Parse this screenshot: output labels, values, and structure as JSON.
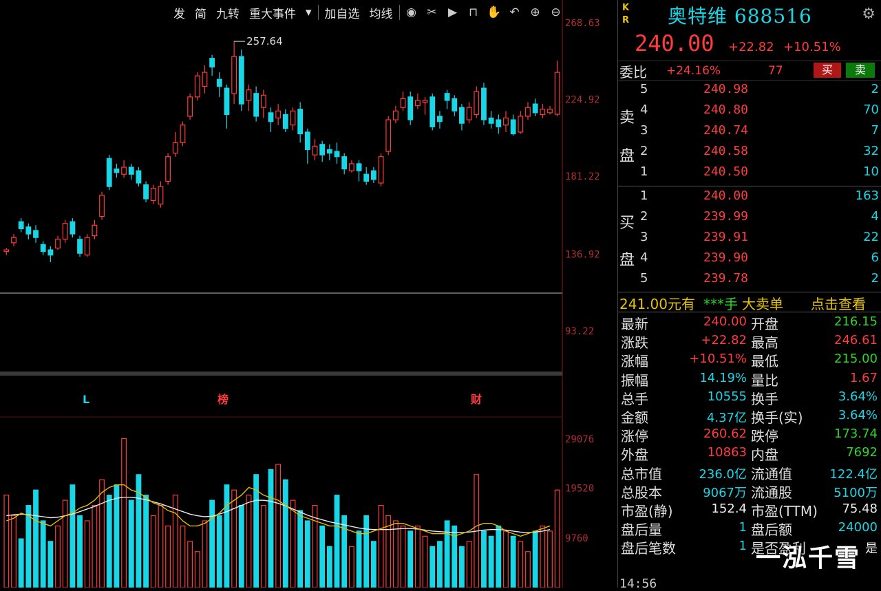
{
  "toolbar": {
    "items": [
      "发",
      "简",
      "九转",
      "重大事件",
      "加自选",
      "均线"
    ],
    "icons": [
      "eye-icon",
      "scissors-icon",
      "play-icon",
      "lock-icon",
      "hand-icon",
      "undo-icon",
      "zoom-in-icon",
      "zoom-out-icon"
    ]
  },
  "stock": {
    "kr": [
      "K",
      "R"
    ],
    "name": "奥特维 688516",
    "price": "240.00",
    "change": "+22.82",
    "change_pct": "+10.51%"
  },
  "weibi": {
    "label": "委比",
    "pct": "+24.16%",
    "diff": "77",
    "buy_btn": "买",
    "sell_btn": "卖"
  },
  "asks": {
    "side_label_1": "卖",
    "side_label_2": "盘",
    "rows": [
      {
        "lv": "5",
        "px": "240.98",
        "vol": "2"
      },
      {
        "lv": "4",
        "px": "240.80",
        "vol": "70"
      },
      {
        "lv": "3",
        "px": "240.74",
        "vol": "7"
      },
      {
        "lv": "2",
        "px": "240.58",
        "vol": "32"
      },
      {
        "lv": "1",
        "px": "240.50",
        "vol": "10"
      }
    ]
  },
  "bids": {
    "side_label_1": "买",
    "side_label_2": "盘",
    "rows": [
      {
        "lv": "1",
        "px": "240.00",
        "vol": "163"
      },
      {
        "lv": "2",
        "px": "239.99",
        "vol": "4"
      },
      {
        "lv": "3",
        "px": "239.91",
        "vol": "22"
      },
      {
        "lv": "4",
        "px": "239.90",
        "vol": "6"
      },
      {
        "lv": "5",
        "px": "239.78",
        "vol": "2"
      }
    ]
  },
  "ad": {
    "price": "241.00元有",
    "hand": "***手",
    "big": "大卖单",
    "link": "点击查看"
  },
  "stats": [
    {
      "k1": "最新",
      "v1": "240.00",
      "c1": "red",
      "k2": "开盘",
      "v2": "216.15",
      "c2": "green"
    },
    {
      "k1": "涨跌",
      "v1": "+22.82",
      "c1": "red",
      "k2": "最高",
      "v2": "246.61",
      "c2": "red"
    },
    {
      "k1": "涨幅",
      "v1": "+10.51%",
      "c1": "red",
      "k2": "最低",
      "v2": "215.00",
      "c2": "green"
    },
    {
      "k1": "振幅",
      "v1": "14.19%",
      "c1": "cyan",
      "k2": "量比",
      "v2": "1.67",
      "c2": "red"
    },
    {
      "k1": "总手",
      "v1": "10555",
      "c1": "cyan",
      "k2": "换手",
      "v2": "3.64%",
      "c2": "cyan"
    },
    {
      "k1": "金额",
      "v1": "4.37亿",
      "c1": "cyan",
      "k2": "换手(实)",
      "v2": "3.64%",
      "c2": "cyan"
    },
    {
      "k1": "涨停",
      "v1": "260.62",
      "c1": "red",
      "k2": "跌停",
      "v2": "173.74",
      "c2": "green"
    },
    {
      "k1": "外盘",
      "v1": "10863",
      "c1": "red",
      "k2": "内盘",
      "v2": "7692",
      "c2": "green"
    },
    {
      "k1": "总市值",
      "v1": "236.0亿",
      "c1": "cyan",
      "k2": "流通值",
      "v2": "122.4亿",
      "c2": "cyan"
    },
    {
      "k1": "总股本",
      "v1": "9067万",
      "c1": "cyan",
      "k2": "流通股",
      "v2": "5100万",
      "c2": "cyan"
    },
    {
      "k1": "市盈(静)",
      "v1": "152.4",
      "c1": "white",
      "k2": "市盈(TTM)",
      "v2": "75.48",
      "c2": "white"
    },
    {
      "k1": "盘后量",
      "v1": "1",
      "c1": "cyan",
      "k2": "盘后额",
      "v2": "24000",
      "c2": "cyan"
    },
    {
      "k1": "盘后笔数",
      "v1": "1",
      "c1": "cyan",
      "k2": "是否盈利",
      "v2": "是",
      "c2": "white"
    }
  ],
  "watermark": "一泓千雪",
  "bottom_time": "14:56",
  "chart_data": {
    "type": "candlestick",
    "price_axis_ticks": [
      "268.63",
      "224.92",
      "181.22",
      "136.92",
      "93.22"
    ],
    "ylim": [
      93.22,
      268.63
    ],
    "peak_label": "257.64",
    "event_markers": [
      "L",
      "榜",
      "财"
    ],
    "volume_axis_ticks": [
      "29076",
      "19520",
      "9760"
    ],
    "volume_ylim": [
      0,
      29076
    ],
    "candles": [
      {
        "o": 138,
        "c": 139,
        "h": 140,
        "l": 136,
        "up": true
      },
      {
        "o": 143,
        "c": 146,
        "h": 148,
        "l": 141,
        "up": true
      },
      {
        "o": 155,
        "c": 151,
        "h": 157,
        "l": 149,
        "up": false
      },
      {
        "o": 152,
        "c": 148,
        "h": 154,
        "l": 145,
        "up": false
      },
      {
        "o": 150,
        "c": 146,
        "h": 153,
        "l": 143,
        "up": false
      },
      {
        "o": 142,
        "c": 138,
        "h": 144,
        "l": 136,
        "up": false
      },
      {
        "o": 139,
        "c": 136,
        "h": 141,
        "l": 132,
        "up": false
      },
      {
        "o": 140,
        "c": 145,
        "h": 147,
        "l": 139,
        "up": true
      },
      {
        "o": 145,
        "c": 154,
        "h": 156,
        "l": 143,
        "up": true
      },
      {
        "o": 155,
        "c": 148,
        "h": 157,
        "l": 146,
        "up": false
      },
      {
        "o": 145,
        "c": 137,
        "h": 147,
        "l": 135,
        "up": false
      },
      {
        "o": 136,
        "c": 146,
        "h": 148,
        "l": 135,
        "up": true
      },
      {
        "o": 147,
        "c": 153,
        "h": 156,
        "l": 145,
        "up": true
      },
      {
        "o": 158,
        "c": 170,
        "h": 172,
        "l": 156,
        "up": true
      },
      {
        "o": 191,
        "c": 175,
        "h": 193,
        "l": 173,
        "up": false
      },
      {
        "o": 185,
        "c": 183,
        "h": 188,
        "l": 180,
        "up": false
      },
      {
        "o": 182,
        "c": 186,
        "h": 190,
        "l": 180,
        "up": true
      },
      {
        "o": 186,
        "c": 182,
        "h": 188,
        "l": 179,
        "up": false
      },
      {
        "o": 184,
        "c": 177,
        "h": 186,
        "l": 175,
        "up": false
      },
      {
        "o": 176,
        "c": 168,
        "h": 178,
        "l": 166,
        "up": false
      },
      {
        "o": 167,
        "c": 174,
        "h": 176,
        "l": 165,
        "up": true
      },
      {
        "o": 165,
        "c": 175,
        "h": 178,
        "l": 163,
        "up": true
      },
      {
        "o": 178,
        "c": 192,
        "h": 194,
        "l": 176,
        "up": true
      },
      {
        "o": 194,
        "c": 200,
        "h": 206,
        "l": 192,
        "up": true
      },
      {
        "o": 200,
        "c": 210,
        "h": 212,
        "l": 198,
        "up": true
      },
      {
        "o": 215,
        "c": 226,
        "h": 228,
        "l": 213,
        "up": true
      },
      {
        "o": 226,
        "c": 238,
        "h": 240,
        "l": 224,
        "up": true
      },
      {
        "o": 232,
        "c": 240,
        "h": 244,
        "l": 228,
        "up": true
      },
      {
        "o": 248,
        "c": 243,
        "h": 250,
        "l": 238,
        "up": false
      },
      {
        "o": 236,
        "c": 232,
        "h": 240,
        "l": 226,
        "up": false
      },
      {
        "o": 231,
        "c": 216,
        "h": 233,
        "l": 208,
        "up": false
      },
      {
        "o": 228,
        "c": 249,
        "h": 257.64,
        "l": 222,
        "up": true
      },
      {
        "o": 249,
        "c": 222,
        "h": 253,
        "l": 218,
        "up": false
      },
      {
        "o": 224,
        "c": 230,
        "h": 233,
        "l": 218,
        "up": true
      },
      {
        "o": 228,
        "c": 215,
        "h": 232,
        "l": 212,
        "up": false
      },
      {
        "o": 220,
        "c": 227,
        "h": 230,
        "l": 214,
        "up": true
      },
      {
        "o": 217,
        "c": 212,
        "h": 220,
        "l": 206,
        "up": false
      },
      {
        "o": 214,
        "c": 218,
        "h": 222,
        "l": 210,
        "up": true
      },
      {
        "o": 216,
        "c": 208,
        "h": 219,
        "l": 206,
        "up": false
      },
      {
        "o": 210,
        "c": 218,
        "h": 220,
        "l": 207,
        "up": true
      },
      {
        "o": 219,
        "c": 205,
        "h": 223,
        "l": 200,
        "up": false
      },
      {
        "o": 206,
        "c": 196,
        "h": 208,
        "l": 188,
        "up": false
      },
      {
        "o": 193,
        "c": 198,
        "h": 202,
        "l": 190,
        "up": true
      },
      {
        "o": 199,
        "c": 193,
        "h": 201,
        "l": 189,
        "up": false
      },
      {
        "o": 196,
        "c": 194,
        "h": 199,
        "l": 190,
        "up": false
      },
      {
        "o": 195,
        "c": 192,
        "h": 200,
        "l": 188,
        "up": false
      },
      {
        "o": 192,
        "c": 185,
        "h": 194,
        "l": 182,
        "up": false
      },
      {
        "o": 184,
        "c": 188,
        "h": 190,
        "l": 183,
        "up": true
      },
      {
        "o": 188,
        "c": 184,
        "h": 190,
        "l": 178,
        "up": false
      },
      {
        "o": 182,
        "c": 178,
        "h": 186,
        "l": 176,
        "up": false
      },
      {
        "o": 184,
        "c": 179,
        "h": 186,
        "l": 177,
        "up": false
      },
      {
        "o": 177,
        "c": 192,
        "h": 194,
        "l": 175,
        "up": true
      },
      {
        "o": 195,
        "c": 213,
        "h": 215,
        "l": 193,
        "up": true
      },
      {
        "o": 213,
        "c": 218,
        "h": 221,
        "l": 211,
        "up": true
      },
      {
        "o": 220,
        "c": 225,
        "h": 229,
        "l": 218,
        "up": true
      },
      {
        "o": 226,
        "c": 213,
        "h": 229,
        "l": 210,
        "up": false
      },
      {
        "o": 221,
        "c": 224,
        "h": 228,
        "l": 219,
        "up": true
      },
      {
        "o": 223,
        "c": 224,
        "h": 226,
        "l": 216,
        "up": true
      },
      {
        "o": 226,
        "c": 209,
        "h": 228,
        "l": 207,
        "up": false
      },
      {
        "o": 215,
        "c": 212,
        "h": 218,
        "l": 208,
        "up": false
      },
      {
        "o": 228,
        "c": 224,
        "h": 230,
        "l": 219,
        "up": false
      },
      {
        "o": 225,
        "c": 218,
        "h": 227,
        "l": 215,
        "up": false
      },
      {
        "o": 220,
        "c": 211,
        "h": 222,
        "l": 207,
        "up": false
      },
      {
        "o": 213,
        "c": 220,
        "h": 223,
        "l": 211,
        "up": true
      },
      {
        "o": 216,
        "c": 229,
        "h": 232,
        "l": 214,
        "up": true
      },
      {
        "o": 231,
        "c": 213,
        "h": 234,
        "l": 210,
        "up": false
      },
      {
        "o": 214,
        "c": 211,
        "h": 218,
        "l": 208,
        "up": false
      },
      {
        "o": 213,
        "c": 209,
        "h": 216,
        "l": 205,
        "up": false
      },
      {
        "o": 210,
        "c": 214,
        "h": 218,
        "l": 206,
        "up": true
      },
      {
        "o": 213,
        "c": 205,
        "h": 216,
        "l": 204,
        "up": false
      },
      {
        "o": 206,
        "c": 215,
        "h": 218,
        "l": 205,
        "up": true
      },
      {
        "o": 215,
        "c": 220,
        "h": 223,
        "l": 213,
        "up": true
      },
      {
        "o": 222,
        "c": 217,
        "h": 225,
        "l": 215,
        "up": false
      },
      {
        "o": 216,
        "c": 219,
        "h": 222,
        "l": 214,
        "up": true
      },
      {
        "o": 217,
        "c": 219,
        "h": 221,
        "l": 216,
        "up": true
      },
      {
        "o": 216.15,
        "c": 240,
        "h": 246.61,
        "l": 215,
        "up": true
      }
    ],
    "volumes": [
      18000,
      14000,
      9500,
      16000,
      19000,
      13000,
      9000,
      12000,
      17000,
      20000,
      14000,
      13000,
      16000,
      21000,
      18000,
      20000,
      29000,
      17000,
      22000,
      18000,
      14000,
      16000,
      12000,
      18000,
      12000,
      9000,
      7000,
      13000,
      17000,
      14000,
      20000,
      19000,
      16000,
      18000,
      22000,
      16000,
      23000,
      24000,
      21000,
      17000,
      15000,
      13000,
      16000,
      12000,
      8000,
      18000,
      14000,
      8000,
      11000,
      14000,
      9000,
      16000,
      14000,
      13000,
      12000,
      11000,
      12000,
      10000,
      8000,
      9000,
      13000,
      12000,
      8000,
      9000,
      22000,
      11000,
      10000,
      12000,
      11000,
      10000,
      9000,
      7000,
      11000,
      12000,
      11000,
      19000
    ],
    "ma5_volume": [
      13000,
      13500,
      14500,
      14000,
      13000,
      12500,
      12000,
      13000,
      14000,
      14500,
      15500,
      16000,
      17000,
      18500,
      19500,
      20000,
      20000,
      19000,
      18500,
      17500,
      16500,
      16000,
      15000,
      14500,
      13000,
      12000,
      12000,
      12500,
      13500,
      14500,
      16000,
      17000,
      18000,
      19500,
      19000,
      18000,
      17500,
      17000,
      16000,
      15000,
      14000,
      13500,
      13000,
      12500,
      12000,
      12000,
      11500,
      11000,
      10500,
      10500,
      11000,
      11500,
      12000,
      12500,
      12500,
      12000,
      11500,
      11000,
      10500,
      10500,
      10500,
      10000,
      10500,
      11000,
      12000,
      12500,
      12500,
      12000,
      11000,
      10500,
      10000,
      10500,
      11000,
      11500,
      12000
    ],
    "ma10_volume": [
      14000,
      14200,
      14300,
      14200,
      14000,
      13800,
      13600,
      13700,
      14000,
      14300,
      14800,
      15300,
      15800,
      16400,
      17000,
      17400,
      17600,
      17600,
      17400,
      17100,
      16700,
      16300,
      15800,
      15300,
      14800,
      14300,
      14000,
      13800,
      13900,
      14300,
      14800,
      15400,
      16000,
      16600,
      17000,
      17000,
      16800,
      16400,
      15900,
      15300,
      14700,
      14100,
      13600,
      13200,
      12800,
      12500,
      12200,
      11900,
      11600,
      11400,
      11300,
      11300,
      11300,
      11400,
      11500,
      11500,
      11400,
      11200,
      11000,
      10900,
      10800,
      10700,
      10700,
      10800,
      11000,
      11200,
      11300,
      11300,
      11200,
      11000,
      10800,
      10700,
      10800,
      11000,
      11300
    ]
  }
}
